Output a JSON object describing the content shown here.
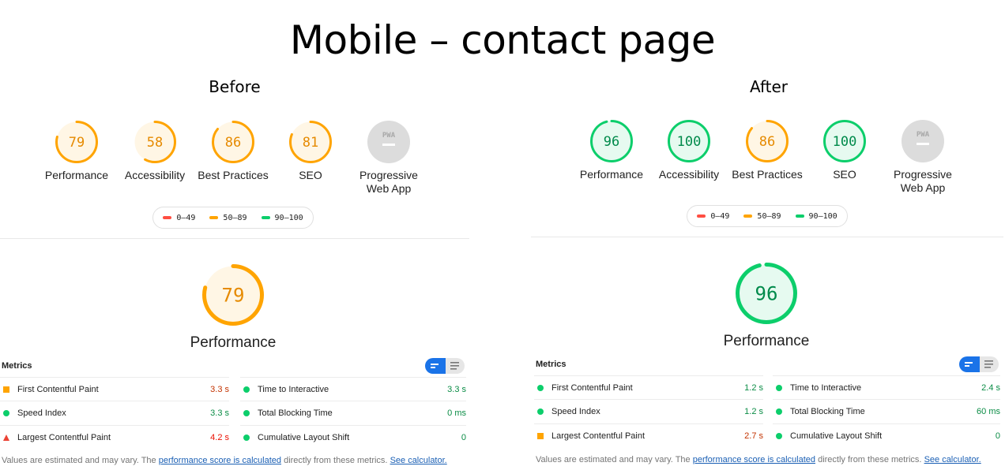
{
  "title": "Mobile – contact page",
  "colors": {
    "pass": "#0cce6b",
    "average": "#ffa400",
    "fail": "#ff4e42",
    "na": "#e0e0e0"
  },
  "panels": [
    {
      "heading": "Before",
      "scores": [
        {
          "label": "Performance",
          "score": "79",
          "status": "average"
        },
        {
          "label": "Accessibility",
          "score": "58",
          "status": "average"
        },
        {
          "label": "Best Practices",
          "score": "86",
          "status": "average"
        },
        {
          "label": "SEO",
          "score": "81",
          "status": "average"
        },
        {
          "label": "Progressive Web App",
          "score": "",
          "status": "na",
          "icon": "pwa-icon",
          "icon_text": "PWA"
        }
      ],
      "legend": [
        "0–49",
        "50–89",
        "90–100"
      ],
      "main": {
        "label": "Performance",
        "score": "79",
        "status": "average"
      },
      "metrics_title": "Metrics",
      "metrics_left": [
        {
          "name": "First Contentful Paint",
          "value": "3.3 s",
          "status": "average"
        },
        {
          "name": "Speed Index",
          "value": "3.3 s",
          "status": "pass"
        },
        {
          "name": "Largest Contentful Paint",
          "value": "4.2 s",
          "status": "fail"
        }
      ],
      "metrics_right": [
        {
          "name": "Time to Interactive",
          "value": "3.3 s",
          "status": "pass"
        },
        {
          "name": "Total Blocking Time",
          "value": "0 ms",
          "status": "pass"
        },
        {
          "name": "Cumulative Layout Shift",
          "value": "0",
          "status": "pass"
        }
      ],
      "footnote": {
        "text1": "Values are estimated and may vary. The ",
        "link1": "performance score is calculated",
        "text2": " directly from these metrics. ",
        "link2": "See calculator."
      }
    },
    {
      "heading": "After",
      "scores": [
        {
          "label": "Performance",
          "score": "96",
          "status": "pass"
        },
        {
          "label": "Accessibility",
          "score": "100",
          "status": "pass"
        },
        {
          "label": "Best Practices",
          "score": "86",
          "status": "average"
        },
        {
          "label": "SEO",
          "score": "100",
          "status": "pass"
        },
        {
          "label": "Progressive Web App",
          "score": "",
          "status": "na",
          "icon": "pwa-icon",
          "icon_text": "PWA"
        }
      ],
      "legend": [
        "0–49",
        "50–89",
        "90–100"
      ],
      "main": {
        "label": "Performance",
        "score": "96",
        "status": "pass"
      },
      "metrics_title": "Metrics",
      "metrics_left": [
        {
          "name": "First Contentful Paint",
          "value": "1.2 s",
          "status": "pass"
        },
        {
          "name": "Speed Index",
          "value": "1.2 s",
          "status": "pass"
        },
        {
          "name": "Largest Contentful Paint",
          "value": "2.7 s",
          "status": "average"
        }
      ],
      "metrics_right": [
        {
          "name": "Time to Interactive",
          "value": "2.4 s",
          "status": "pass"
        },
        {
          "name": "Total Blocking Time",
          "value": "60 ms",
          "status": "pass"
        },
        {
          "name": "Cumulative Layout Shift",
          "value": "0",
          "status": "pass"
        }
      ],
      "footnote": {
        "text1": "Values are estimated and may vary. The ",
        "link1": "performance score is calculated",
        "text2": " directly from these metrics. ",
        "link2": "See calculator."
      }
    }
  ]
}
